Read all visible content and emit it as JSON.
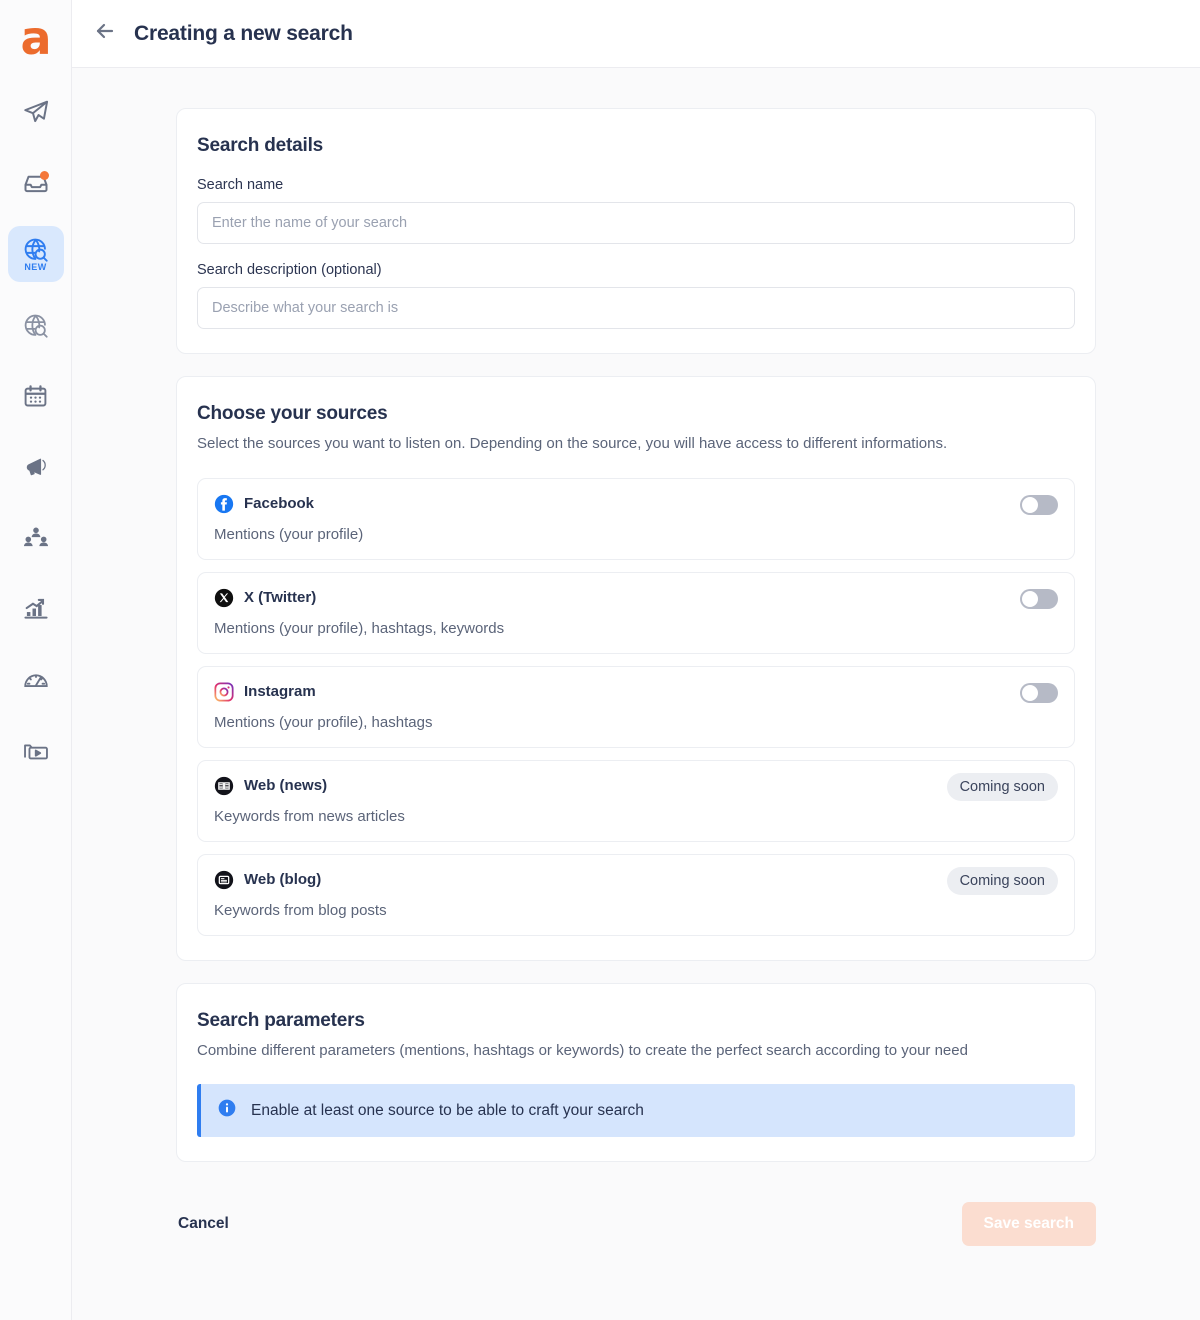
{
  "app": {
    "logo_glyph": "a",
    "logo_color": "#ec6b2d"
  },
  "sidebar": {
    "items": [
      {
        "name": "send",
        "icon": "paper-plane-icon",
        "label": "",
        "active": false,
        "badge": false
      },
      {
        "name": "inbox",
        "icon": "inbox-icon",
        "label": "",
        "active": false,
        "badge": true
      },
      {
        "name": "new-search",
        "icon": "globe-search-icon",
        "label": "NEW",
        "active": true,
        "badge": false
      },
      {
        "name": "search",
        "icon": "globe-search-outline-icon",
        "label": "",
        "active": false,
        "badge": false
      },
      {
        "name": "calendar",
        "icon": "calendar-icon",
        "label": "",
        "active": false,
        "badge": false
      },
      {
        "name": "campaigns",
        "icon": "megaphone-icon",
        "label": "",
        "active": false,
        "badge": false
      },
      {
        "name": "audience",
        "icon": "people-icon",
        "label": "",
        "active": false,
        "badge": false
      },
      {
        "name": "analytics",
        "icon": "bar-chart-icon",
        "label": "",
        "active": false,
        "badge": false
      },
      {
        "name": "performance",
        "icon": "gauge-icon",
        "label": "",
        "active": false,
        "badge": false
      },
      {
        "name": "media",
        "icon": "media-folder-icon",
        "label": "",
        "active": false,
        "badge": false
      }
    ]
  },
  "header": {
    "title": "Creating a new search",
    "back_icon": "arrow-left-icon"
  },
  "search_details": {
    "title": "Search details",
    "name_label": "Search name",
    "name_placeholder": "Enter the name of your search",
    "name_value": "",
    "description_label": "Search description (optional)",
    "description_placeholder": "Describe what your search is",
    "description_value": ""
  },
  "sources": {
    "title": "Choose your sources",
    "subtitle": "Select the sources you want to listen on. Depending on the source, you will have access to different informations.",
    "items": [
      {
        "name": "Facebook",
        "description": "Mentions (your profile)",
        "icon": "facebook-icon",
        "control": "toggle",
        "enabled": false,
        "brand_color": "#1877f2"
      },
      {
        "name": "X (Twitter)",
        "description": "Mentions (your profile), hashtags, keywords",
        "icon": "x-twitter-icon",
        "control": "toggle",
        "enabled": false,
        "brand_color": "#0f0f0f"
      },
      {
        "name": "Instagram",
        "description": "Mentions (your profile), hashtags",
        "icon": "instagram-icon",
        "control": "toggle",
        "enabled": false,
        "brand_color": "#d6249f"
      },
      {
        "name": "Web (news)",
        "description": "Keywords from news articles",
        "icon": "web-news-icon",
        "control": "badge",
        "badge_label": "Coming soon",
        "brand_color": "#12131a"
      },
      {
        "name": "Web (blog)",
        "description": "Keywords from blog posts",
        "icon": "web-blog-icon",
        "control": "badge",
        "badge_label": "Coming soon",
        "brand_color": "#12131a"
      }
    ]
  },
  "parameters": {
    "title": "Search parameters",
    "subtitle": "Combine different parameters (mentions, hashtags or keywords) to create the perfect search according to your need",
    "banner_text": "Enable at least one source to be able to craft your search",
    "banner_icon": "info-icon",
    "banner_bg": "#d5e5fd",
    "banner_accent": "#2f7df0"
  },
  "footer": {
    "cancel_label": "Cancel",
    "save_label": "Save search",
    "save_disabled": true,
    "save_bg": "#fbddd0"
  }
}
